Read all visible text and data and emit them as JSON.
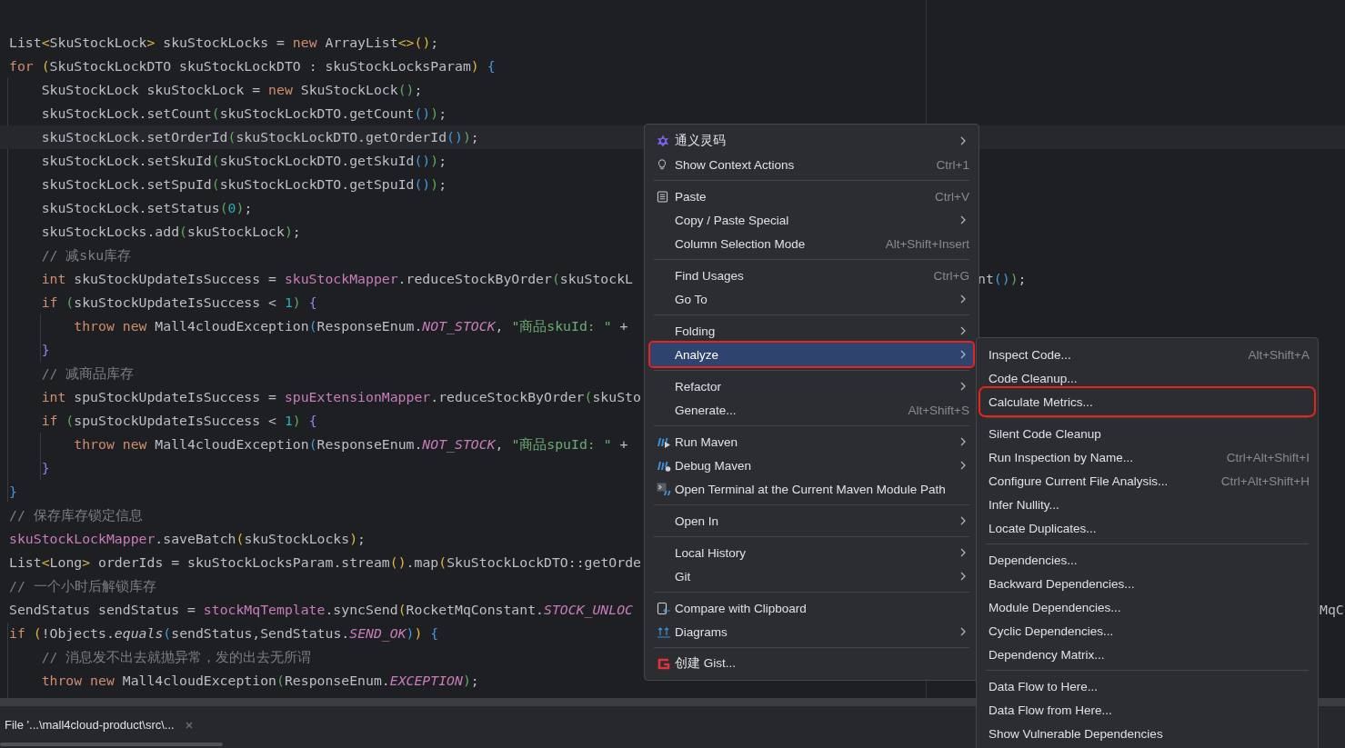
{
  "editor": {
    "lines": [
      {
        "current": false,
        "tokens": [
          {
            "kind": "id",
            "t": "List"
          },
          {
            "kind": "gold",
            "t": "<"
          },
          {
            "kind": "id",
            "t": "SkuStockLock"
          },
          {
            "kind": "gold",
            "t": ">"
          },
          {
            "kind": "id",
            "t": " skuStockLocks = "
          },
          {
            "kind": "kw",
            "t": "new"
          },
          {
            "kind": "id",
            "t": " ArrayList"
          },
          {
            "kind": "gold",
            "t": "<>()"
          },
          {
            "kind": "id",
            "t": ";"
          }
        ]
      },
      {
        "current": false,
        "tokens": [
          {
            "kind": "kw",
            "t": "for "
          },
          {
            "kind": "gold",
            "t": "("
          },
          {
            "kind": "id",
            "t": "SkuStockLockDTO skuStockLockDTO : skuStockLocksParam"
          },
          {
            "kind": "gold",
            "t": ") "
          },
          {
            "kind": "blue",
            "t": "{"
          }
        ]
      },
      {
        "current": false,
        "tokens": [
          {
            "kind": "id",
            "t": "    SkuStockLock skuStockLock = "
          },
          {
            "kind": "kw",
            "t": "new"
          },
          {
            "kind": "id",
            "t": " SkuStockLock"
          },
          {
            "kind": "green",
            "t": "()"
          },
          {
            "kind": "id",
            "t": ";"
          }
        ]
      },
      {
        "current": false,
        "tokens": [
          {
            "kind": "id",
            "t": "    skuStockLock.setCount"
          },
          {
            "kind": "green",
            "t": "("
          },
          {
            "kind": "id",
            "t": "skuStockLockDTO.getCount"
          },
          {
            "kind": "blue",
            "t": "()"
          },
          {
            "kind": "green",
            "t": ")"
          },
          {
            "kind": "id",
            "t": ";"
          }
        ]
      },
      {
        "current": true,
        "tokens": [
          {
            "kind": "id",
            "t": "    skuStockLock.setOrderId"
          },
          {
            "kind": "green",
            "t": "("
          },
          {
            "kind": "id",
            "t": "skuStockLockDTO.getOrderId"
          },
          {
            "kind": "blue",
            "t": "()"
          },
          {
            "kind": "green",
            "t": ")"
          },
          {
            "kind": "id",
            "t": ";"
          }
        ]
      },
      {
        "current": false,
        "tokens": [
          {
            "kind": "id",
            "t": "    skuStockLock.setSkuId"
          },
          {
            "kind": "green",
            "t": "("
          },
          {
            "kind": "id",
            "t": "skuStockLockDTO.getSkuId"
          },
          {
            "kind": "blue",
            "t": "()"
          },
          {
            "kind": "green",
            "t": ")"
          },
          {
            "kind": "id",
            "t": ";"
          }
        ]
      },
      {
        "current": false,
        "tokens": [
          {
            "kind": "id",
            "t": "    skuStockLock.setSpuId"
          },
          {
            "kind": "green",
            "t": "("
          },
          {
            "kind": "id",
            "t": "skuStockLockDTO.getSpuId"
          },
          {
            "kind": "blue",
            "t": "()"
          },
          {
            "kind": "green",
            "t": ")"
          },
          {
            "kind": "id",
            "t": ";"
          }
        ]
      },
      {
        "current": false,
        "tokens": [
          {
            "kind": "id",
            "t": "    skuStockLock.setStatus"
          },
          {
            "kind": "green",
            "t": "("
          },
          {
            "kind": "num",
            "t": "0"
          },
          {
            "kind": "green",
            "t": ")"
          },
          {
            "kind": "id",
            "t": ";"
          }
        ]
      },
      {
        "current": false,
        "tokens": [
          {
            "kind": "id",
            "t": "    skuStockLocks.add"
          },
          {
            "kind": "green",
            "t": "("
          },
          {
            "kind": "id",
            "t": "skuStockLock"
          },
          {
            "kind": "green",
            "t": ")"
          },
          {
            "kind": "id",
            "t": ";"
          }
        ]
      },
      {
        "current": false,
        "tokens": [
          {
            "kind": "cmt",
            "t": "    // 减sku库存"
          }
        ]
      },
      {
        "current": false,
        "tokens": [
          {
            "kind": "kw",
            "t": "    int"
          },
          {
            "kind": "id",
            "t": " skuStockUpdateIsSuccess = "
          },
          {
            "kind": "fld",
            "t": "skuStockMapper"
          },
          {
            "kind": "id",
            "t": ".reduceStockByOrder"
          },
          {
            "kind": "green",
            "t": "("
          },
          {
            "kind": "id",
            "t": "skuStockL"
          }
        ],
        "tail_after_menu": [
          {
            "kind": "id",
            "t": "nt"
          },
          {
            "kind": "blue",
            "t": "()"
          },
          {
            "kind": "green",
            "t": ")"
          },
          {
            "kind": "id",
            "t": ";"
          }
        ]
      },
      {
        "current": false,
        "tokens": [
          {
            "kind": "kw",
            "t": "    if "
          },
          {
            "kind": "green",
            "t": "("
          },
          {
            "kind": "id",
            "t": "skuStockUpdateIsSuccess < "
          },
          {
            "kind": "num",
            "t": "1"
          },
          {
            "kind": "green",
            "t": ") "
          },
          {
            "kind": "purple",
            "t": "{"
          }
        ]
      },
      {
        "current": false,
        "tokens": [
          {
            "kind": "kw",
            "t": "        throw new"
          },
          {
            "kind": "id",
            "t": " Mall4cloudException"
          },
          {
            "kind": "blue",
            "t": "("
          },
          {
            "kind": "id",
            "t": "ResponseEnum."
          },
          {
            "kind": "ita",
            "t": "NOT_STOCK"
          },
          {
            "kind": "id",
            "t": ", "
          },
          {
            "kind": "str",
            "t": "\"商品skuId: \""
          },
          {
            "kind": "id",
            "t": " +"
          }
        ]
      },
      {
        "current": false,
        "tokens": [
          {
            "kind": "purple",
            "t": "    }"
          }
        ]
      },
      {
        "current": false,
        "tokens": [
          {
            "kind": "cmt",
            "t": "    // 减商品库存"
          }
        ]
      },
      {
        "current": false,
        "tokens": [
          {
            "kind": "kw",
            "t": "    int"
          },
          {
            "kind": "id",
            "t": " spuStockUpdateIsSuccess = "
          },
          {
            "kind": "fld",
            "t": "spuExtensionMapper"
          },
          {
            "kind": "id",
            "t": ".reduceStockByOrder"
          },
          {
            "kind": "green",
            "t": "("
          },
          {
            "kind": "id",
            "t": "skuSto"
          }
        ]
      },
      {
        "current": false,
        "tokens": [
          {
            "kind": "kw",
            "t": "    if "
          },
          {
            "kind": "green",
            "t": "("
          },
          {
            "kind": "id",
            "t": "spuStockUpdateIsSuccess < "
          },
          {
            "kind": "num",
            "t": "1"
          },
          {
            "kind": "green",
            "t": ") "
          },
          {
            "kind": "purple",
            "t": "{"
          }
        ]
      },
      {
        "current": false,
        "tokens": [
          {
            "kind": "kw",
            "t": "        throw new"
          },
          {
            "kind": "id",
            "t": " Mall4cloudException"
          },
          {
            "kind": "blue",
            "t": "("
          },
          {
            "kind": "id",
            "t": "ResponseEnum."
          },
          {
            "kind": "ita",
            "t": "NOT_STOCK"
          },
          {
            "kind": "id",
            "t": ", "
          },
          {
            "kind": "str",
            "t": "\"商品spuId: \""
          },
          {
            "kind": "id",
            "t": " +"
          }
        ]
      },
      {
        "current": false,
        "tokens": [
          {
            "kind": "purple",
            "t": "    }"
          }
        ]
      },
      {
        "current": false,
        "tokens": [
          {
            "kind": "blue",
            "t": "}"
          }
        ]
      },
      {
        "current": false,
        "tokens": [
          {
            "kind": "cmt",
            "t": "// 保存库存锁定信息"
          }
        ]
      },
      {
        "current": false,
        "tokens": [
          {
            "kind": "fld",
            "t": "skuStockLockMapper"
          },
          {
            "kind": "id",
            "t": ".saveBatch"
          },
          {
            "kind": "gold",
            "t": "("
          },
          {
            "kind": "id",
            "t": "skuStockLocks"
          },
          {
            "kind": "gold",
            "t": ")"
          },
          {
            "kind": "id",
            "t": ";"
          }
        ]
      },
      {
        "current": false,
        "tokens": [
          {
            "kind": "id",
            "t": "List"
          },
          {
            "kind": "gold",
            "t": "<"
          },
          {
            "kind": "id",
            "t": "Long"
          },
          {
            "kind": "gold",
            "t": ">"
          },
          {
            "kind": "id",
            "t": " orderIds = skuStockLocksParam.stream"
          },
          {
            "kind": "gold",
            "t": "()"
          },
          {
            "kind": "id",
            "t": ".map"
          },
          {
            "kind": "gold",
            "t": "("
          },
          {
            "kind": "id",
            "t": "SkuStockLockDTO::getOrde"
          }
        ]
      },
      {
        "current": false,
        "tokens": [
          {
            "kind": "cmt",
            "t": "// 一个小时后解锁库存"
          }
        ]
      },
      {
        "current": false,
        "tokens": [
          {
            "kind": "id",
            "t": "SendStatus sendStatus = "
          },
          {
            "kind": "fld",
            "t": "stockMqTemplate"
          },
          {
            "kind": "id",
            "t": ".syncSend"
          },
          {
            "kind": "gold",
            "t": "("
          },
          {
            "kind": "id",
            "t": "RocketMqConstant."
          },
          {
            "kind": "ita",
            "t": "STOCK_UNLOC"
          }
        ],
        "tail_after_submenu": "MqC"
      },
      {
        "current": false,
        "tokens": [
          {
            "kind": "kw",
            "t": "if "
          },
          {
            "kind": "gold",
            "t": "("
          },
          {
            "kind": "id",
            "t": "!Objects."
          },
          {
            "kind": "itm",
            "t": "equals"
          },
          {
            "kind": "blue",
            "t": "("
          },
          {
            "kind": "id",
            "t": "sendStatus,SendStatus."
          },
          {
            "kind": "ita",
            "t": "SEND_OK"
          },
          {
            "kind": "blue",
            "t": ")"
          },
          {
            "kind": "gold",
            "t": ") "
          },
          {
            "kind": "blue",
            "t": "{"
          }
        ]
      },
      {
        "current": false,
        "tokens": [
          {
            "kind": "cmt",
            "t": "    // 消息发不出去就抛异常，发的出去无所谓"
          }
        ]
      },
      {
        "current": false,
        "tokens": [
          {
            "kind": "kw",
            "t": "    throw new"
          },
          {
            "kind": "id",
            "t": " Mall4cloudException"
          },
          {
            "kind": "green",
            "t": "("
          },
          {
            "kind": "id",
            "t": "ResponseEnum."
          },
          {
            "kind": "ita",
            "t": "EXCEPTION"
          },
          {
            "kind": "green",
            "t": ")"
          },
          {
            "kind": "id",
            "t": ";"
          }
        ]
      }
    ]
  },
  "bottom_panel": {
    "tab": "File '...\\mall4cloud-product\\src\\..."
  },
  "context_menu": {
    "items": [
      {
        "kind": "star",
        "label": "通义灵码",
        "submenu": true,
        "selected": false,
        "annotated": false
      },
      {
        "kind": "bulb",
        "label": "Show Context Actions",
        "shortcut": "Ctrl+1",
        "submenu": false,
        "selected": false,
        "annotated": false
      },
      {
        "kind": "separator"
      },
      {
        "kind": "clipboard",
        "label": "Paste",
        "shortcut": "Ctrl+V",
        "submenu": false,
        "selected": false,
        "annotated": false
      },
      {
        "kind": "plain",
        "label": "Copy / Paste Special",
        "submenu": true,
        "selected": false,
        "annotated": false
      },
      {
        "kind": "plain",
        "label": "Column Selection Mode",
        "shortcut": "Alt+Shift+Insert",
        "submenu": false,
        "selected": false,
        "annotated": false
      },
      {
        "kind": "separator"
      },
      {
        "kind": "plain",
        "label": "Find Usages",
        "shortcut": "Ctrl+G",
        "submenu": false,
        "selected": false,
        "annotated": false
      },
      {
        "kind": "plain",
        "label": "Go To",
        "submenu": true,
        "selected": false,
        "annotated": false
      },
      {
        "kind": "separator"
      },
      {
        "kind": "plain",
        "label": "Folding",
        "submenu": true,
        "selected": false,
        "annotated": false
      },
      {
        "kind": "plain",
        "label": "Analyze",
        "submenu": true,
        "selected": true,
        "annotated": true
      },
      {
        "kind": "separator"
      },
      {
        "kind": "plain",
        "label": "Refactor",
        "submenu": true,
        "selected": false,
        "annotated": false
      },
      {
        "kind": "plain",
        "label": "Generate...",
        "shortcut": "Alt+Shift+S",
        "submenu": false,
        "selected": false,
        "annotated": false
      },
      {
        "kind": "separator"
      },
      {
        "kind": "mavenrun",
        "label": "Run Maven",
        "submenu": true,
        "selected": false,
        "annotated": false
      },
      {
        "kind": "mavendebug",
        "label": "Debug Maven",
        "submenu": true,
        "selected": false,
        "annotated": false
      },
      {
        "kind": "terminal",
        "label": "Open Terminal at the Current Maven Module Path",
        "submenu": false,
        "selected": false,
        "annotated": false
      },
      {
        "kind": "separator"
      },
      {
        "kind": "plain",
        "label": "Open In",
        "submenu": true,
        "selected": false,
        "annotated": false
      },
      {
        "kind": "separator"
      },
      {
        "kind": "plain",
        "label": "Local History",
        "submenu": true,
        "selected": false,
        "annotated": false
      },
      {
        "kind": "plain",
        "label": "Git",
        "submenu": true,
        "selected": false,
        "annotated": false
      },
      {
        "kind": "separator"
      },
      {
        "kind": "compare",
        "label": "Compare with Clipboard",
        "submenu": false,
        "selected": false,
        "annotated": false
      },
      {
        "kind": "diagram",
        "label": "Diagrams",
        "submenu": true,
        "selected": false,
        "annotated": false
      },
      {
        "kind": "separator"
      },
      {
        "kind": "gist",
        "label": "创建 Gist...",
        "submenu": false,
        "selected": false,
        "annotated": false
      }
    ]
  },
  "analyze_submenu": {
    "items": [
      {
        "kind": "item",
        "label": "Inspect Code...",
        "shortcut": "Alt+Shift+A",
        "selected": false,
        "annotated": false
      },
      {
        "kind": "item",
        "label": "Code Cleanup...",
        "selected": false,
        "annotated": false
      },
      {
        "kind": "item",
        "label": "Calculate Metrics...",
        "selected": false,
        "annotated": true
      },
      {
        "kind": "separator"
      },
      {
        "kind": "item",
        "label": "Silent Code Cleanup",
        "selected": false,
        "annotated": false
      },
      {
        "kind": "item",
        "label": "Run Inspection by Name...",
        "shortcut": "Ctrl+Alt+Shift+I",
        "selected": false,
        "annotated": false
      },
      {
        "kind": "item",
        "label": "Configure Current File Analysis...",
        "shortcut": "Ctrl+Alt+Shift+H",
        "selected": false,
        "annotated": false
      },
      {
        "kind": "item",
        "label": "Infer Nullity...",
        "selected": false,
        "annotated": false
      },
      {
        "kind": "item",
        "label": "Locate Duplicates...",
        "selected": false,
        "annotated": false
      },
      {
        "kind": "separator"
      },
      {
        "kind": "item",
        "label": "Dependencies...",
        "selected": false,
        "annotated": false
      },
      {
        "kind": "item",
        "label": "Backward Dependencies...",
        "selected": false,
        "annotated": false
      },
      {
        "kind": "item",
        "label": "Module Dependencies...",
        "selected": false,
        "annotated": false
      },
      {
        "kind": "item",
        "label": "Cyclic Dependencies...",
        "selected": false,
        "annotated": false
      },
      {
        "kind": "item",
        "label": "Dependency Matrix...",
        "selected": false,
        "annotated": false
      },
      {
        "kind": "separator"
      },
      {
        "kind": "item",
        "label": "Data Flow to Here...",
        "selected": false,
        "annotated": false
      },
      {
        "kind": "item",
        "label": "Data Flow from Here...",
        "selected": false,
        "annotated": false
      },
      {
        "kind": "item",
        "label": "Show Vulnerable Dependencies",
        "selected": false,
        "annotated": false
      }
    ]
  }
}
